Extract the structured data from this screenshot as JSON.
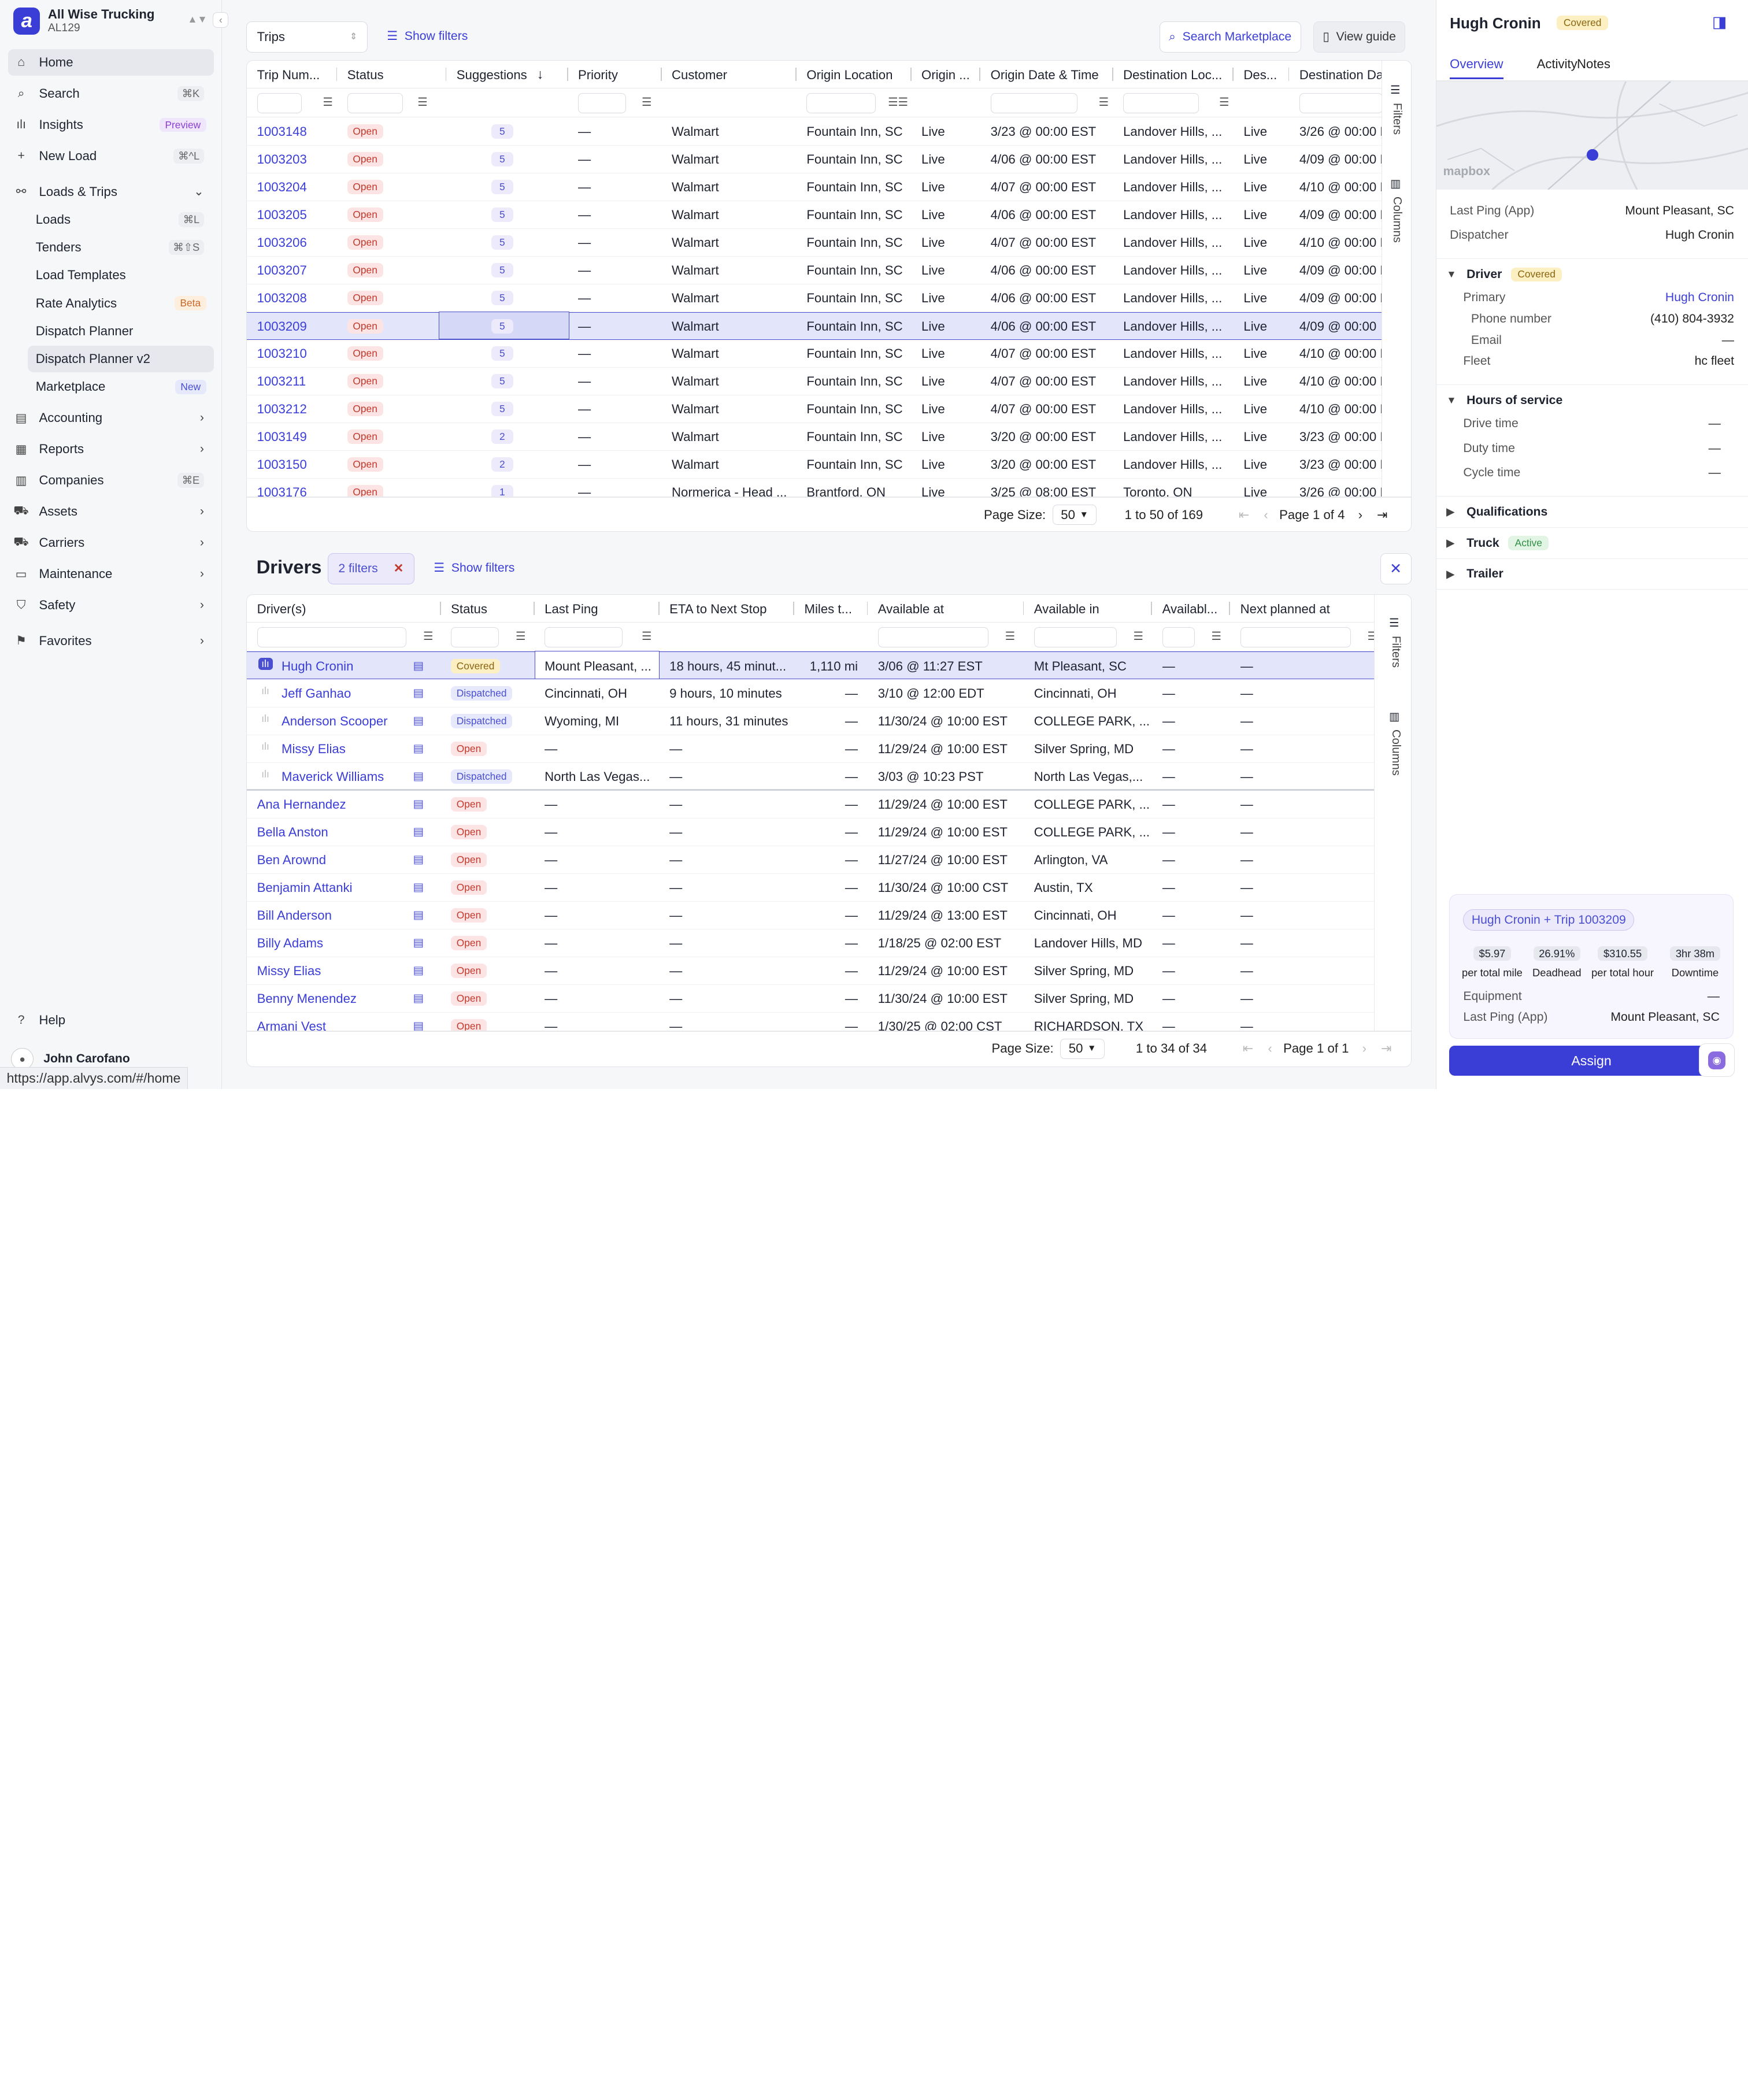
{
  "sidebar": {
    "org_name": "All Wise Trucking",
    "org_code": "AL129",
    "items": [
      {
        "label": "Home",
        "icon": "home-icon",
        "glyph": "⌂"
      },
      {
        "label": "Search",
        "icon": "search-icon",
        "glyph": "⌕",
        "kbd": "⌘K"
      },
      {
        "label": "Insights",
        "icon": "insights-icon",
        "glyph": "ılı",
        "tag": "Preview"
      },
      {
        "label": "New Load",
        "icon": "plus-icon",
        "glyph": "+",
        "kbd": "⌘^L"
      },
      {
        "label": "Loads & Trips",
        "icon": "route-icon",
        "glyph": "⚯"
      },
      {
        "label": "Loads",
        "kbd": "⌘L"
      },
      {
        "label": "Tenders",
        "kbd": "⌘⇧S"
      },
      {
        "label": "Load Templates"
      },
      {
        "label": "Rate Analytics",
        "tag": "Beta"
      },
      {
        "label": "Dispatch Planner"
      },
      {
        "label": "Dispatch Planner v2"
      },
      {
        "label": "Marketplace",
        "tag": "New"
      },
      {
        "label": "Accounting",
        "icon": "accounting-icon",
        "glyph": "▤"
      },
      {
        "label": "Reports",
        "icon": "reports-icon",
        "glyph": "▦"
      },
      {
        "label": "Companies",
        "icon": "companies-icon",
        "glyph": "▥",
        "kbd": "⌘E"
      },
      {
        "label": "Assets",
        "icon": "assets-icon",
        "glyph": "⛟"
      },
      {
        "label": "Carriers",
        "icon": "carriers-icon",
        "glyph": "⛟"
      },
      {
        "label": "Maintenance",
        "icon": "maintenance-icon",
        "glyph": "▭"
      },
      {
        "label": "Safety",
        "icon": "shield-icon",
        "glyph": "⛉"
      },
      {
        "label": "Favorites",
        "icon": "bookmark-icon",
        "glyph": "⚑"
      }
    ],
    "help": "Help",
    "user_name": "John Carofano"
  },
  "status_url": "https://app.alvys.com/#/home",
  "trips": {
    "select_value": "Trips",
    "show_filters": "Show filters",
    "search_marketplace": "Search Marketplace",
    "view_guide": "View guide",
    "columns": [
      "Trip Num...",
      "Status",
      "Suggestions",
      "Priority",
      "Customer",
      "Origin Location",
      "Origin ...",
      "Origin Date & Time",
      "Destination Loc...",
      "Des...",
      "Destination Da"
    ],
    "rows": [
      [
        "1003148",
        "Open",
        "5",
        "—",
        "Walmart",
        "Fountain Inn, SC",
        "Live",
        "3/23 @ 00:00 EST",
        "Landover Hills, ...",
        "Live",
        "3/26 @ 00:00 E"
      ],
      [
        "1003203",
        "Open",
        "5",
        "—",
        "Walmart",
        "Fountain Inn, SC",
        "Live",
        "4/06 @ 00:00 EST",
        "Landover Hills, ...",
        "Live",
        "4/09 @ 00:00 E"
      ],
      [
        "1003204",
        "Open",
        "5",
        "—",
        "Walmart",
        "Fountain Inn, SC",
        "Live",
        "4/07 @ 00:00 EST",
        "Landover Hills, ...",
        "Live",
        "4/10 @ 00:00 E"
      ],
      [
        "1003205",
        "Open",
        "5",
        "—",
        "Walmart",
        "Fountain Inn, SC",
        "Live",
        "4/06 @ 00:00 EST",
        "Landover Hills, ...",
        "Live",
        "4/09 @ 00:00 E"
      ],
      [
        "1003206",
        "Open",
        "5",
        "—",
        "Walmart",
        "Fountain Inn, SC",
        "Live",
        "4/07 @ 00:00 EST",
        "Landover Hills, ...",
        "Live",
        "4/10 @ 00:00 E"
      ],
      [
        "1003207",
        "Open",
        "5",
        "—",
        "Walmart",
        "Fountain Inn, SC",
        "Live",
        "4/06 @ 00:00 EST",
        "Landover Hills, ...",
        "Live",
        "4/09 @ 00:00 E"
      ],
      [
        "1003208",
        "Open",
        "5",
        "—",
        "Walmart",
        "Fountain Inn, SC",
        "Live",
        "4/06 @ 00:00 EST",
        "Landover Hills, ...",
        "Live",
        "4/09 @ 00:00 E"
      ],
      [
        "1003209",
        "Open",
        "5",
        "—",
        "Walmart",
        "Fountain Inn, SC",
        "Live",
        "4/06 @ 00:00 EST",
        "Landover Hills, ...",
        "Live",
        "4/09 @ 00:00"
      ],
      [
        "1003210",
        "Open",
        "5",
        "—",
        "Walmart",
        "Fountain Inn, SC",
        "Live",
        "4/07 @ 00:00 EST",
        "Landover Hills, ...",
        "Live",
        "4/10 @ 00:00 E"
      ],
      [
        "1003211",
        "Open",
        "5",
        "—",
        "Walmart",
        "Fountain Inn, SC",
        "Live",
        "4/07 @ 00:00 EST",
        "Landover Hills, ...",
        "Live",
        "4/10 @ 00:00 E"
      ],
      [
        "1003212",
        "Open",
        "5",
        "—",
        "Walmart",
        "Fountain Inn, SC",
        "Live",
        "4/07 @ 00:00 EST",
        "Landover Hills, ...",
        "Live",
        "4/10 @ 00:00 E"
      ],
      [
        "1003149",
        "Open",
        "2",
        "—",
        "Walmart",
        "Fountain Inn, SC",
        "Live",
        "3/20 @ 00:00 EST",
        "Landover Hills, ...",
        "Live",
        "3/23 @ 00:00 E"
      ],
      [
        "1003150",
        "Open",
        "2",
        "—",
        "Walmart",
        "Fountain Inn, SC",
        "Live",
        "3/20 @ 00:00 EST",
        "Landover Hills, ...",
        "Live",
        "3/23 @ 00:00 E"
      ],
      [
        "1003176",
        "Open",
        "1",
        "—",
        "Normerica - Head ...",
        "Brantford, ON",
        "Live",
        "3/25 @ 08:00 EST",
        "Toronto, ON",
        "Live",
        "3/26 @ 00:00 E"
      ]
    ],
    "page_size_label": "Page Size:",
    "page_size": "50",
    "range": "1 to 50 of 169",
    "page": "Page 1 of 4"
  },
  "drivers": {
    "title": "Drivers",
    "filter_chip": "2 filters",
    "show_filters": "Show filters",
    "columns": [
      "Driver(s)",
      "Status",
      "Last Ping",
      "ETA to Next Stop",
      "Miles t...",
      "Available at",
      "Available in",
      "Availabl...",
      "Next planned at"
    ],
    "rows": [
      [
        "Hugh Cronin",
        "Covered",
        "Mount Pleasant, ...",
        "18 hours, 45 minut...",
        "1,110 mi",
        "3/06 @ 11:27 EST",
        "Mt Pleasant, SC",
        "—",
        "—"
      ],
      [
        "Jeff Ganhao",
        "Dispatched",
        "Cincinnati, OH",
        "9 hours, 10 minutes",
        "—",
        "3/10 @ 12:00 EDT",
        "Cincinnati, OH",
        "—",
        "—"
      ],
      [
        "Anderson Scooper",
        "Dispatched",
        "Wyoming, MI",
        "11 hours, 31 minutes",
        "—",
        "11/30/24 @ 10:00 EST",
        "COLLEGE PARK, ...",
        "—",
        "—"
      ],
      [
        "Missy Elias",
        "Open",
        "—",
        "—",
        "—",
        "11/29/24 @ 10:00 EST",
        "Silver Spring, MD",
        "—",
        "—"
      ],
      [
        "Maverick Williams",
        "Dispatched",
        "North Las Vegas...",
        "—",
        "—",
        "3/03 @ 10:23 PST",
        "North Las Vegas,...",
        "—",
        "—"
      ],
      [
        "Ana Hernandez",
        "Open",
        "—",
        "—",
        "—",
        "11/29/24 @ 10:00 EST",
        "COLLEGE PARK, ...",
        "—",
        "—"
      ],
      [
        "Bella Anston",
        "Open",
        "—",
        "—",
        "—",
        "11/29/24 @ 10:00 EST",
        "COLLEGE PARK, ...",
        "—",
        "—"
      ],
      [
        "Ben Arownd",
        "Open",
        "—",
        "—",
        "—",
        "11/27/24 @ 10:00 EST",
        "Arlington, VA",
        "—",
        "—"
      ],
      [
        "Benjamin Attanki",
        "Open",
        "—",
        "—",
        "—",
        "11/30/24 @ 10:00 CST",
        "Austin, TX",
        "—",
        "—"
      ],
      [
        "Bill Anderson",
        "Open",
        "—",
        "—",
        "—",
        "11/29/24 @ 13:00 EST",
        "Cincinnati, OH",
        "—",
        "—"
      ],
      [
        "Billy Adams",
        "Open",
        "—",
        "—",
        "—",
        "1/18/25 @ 02:00 EST",
        "Landover Hills, MD",
        "—",
        "—"
      ],
      [
        "Missy Elias",
        "Open",
        "—",
        "—",
        "—",
        "11/29/24 @ 10:00 EST",
        "Silver Spring, MD",
        "—",
        "—"
      ],
      [
        "Benny Menendez",
        "Open",
        "—",
        "—",
        "—",
        "11/30/24 @ 10:00 EST",
        "Silver Spring, MD",
        "—",
        "—"
      ],
      [
        "Armani Vest",
        "Open",
        "—",
        "—",
        "—",
        "1/30/25 @ 02:00 CST",
        "RICHARDSON, TX",
        "—",
        "—"
      ]
    ],
    "page_size_label": "Page Size:",
    "page_size": "50",
    "range": "1 to 34 of 34",
    "page": "Page 1 of 1"
  },
  "vertical": {
    "filters": "Filters",
    "columns": "Columns"
  },
  "detail": {
    "name": "Hugh Cronin",
    "badge": "Covered",
    "tabs": [
      "Overview",
      "Activity",
      "Notes"
    ],
    "map_label": "mapbox",
    "last_ping_label": "Last Ping (App)",
    "last_ping": "Mount Pleasant, SC",
    "dispatcher_label": "Dispatcher",
    "dispatcher": "Hugh Cronin",
    "driver_section": "Driver",
    "driver_badge": "Covered",
    "primary_label": "Primary",
    "primary": "Hugh Cronin",
    "phone_label": "Phone number",
    "phone": "(410) 804-3932",
    "email_label": "Email",
    "email": "—",
    "fleet_label": "Fleet",
    "fleet": "hc fleet",
    "hos_section": "Hours of service",
    "drive_label": "Drive time",
    "drive": "—",
    "duty_label": "Duty time",
    "duty": "—",
    "cycle_label": "Cycle time",
    "cycle": "—",
    "qual_section": "Qualifications",
    "truck_section": "Truck",
    "truck_badge": "Active",
    "trailer_section": "Trailer",
    "card_title": "Hugh Cronin + Trip 1003209",
    "metrics": [
      [
        "$5.97",
        "per total mile"
      ],
      [
        "26.91%",
        "Deadhead"
      ],
      [
        "$310.55",
        "per total hour"
      ],
      [
        "3hr 38m",
        "Downtime"
      ]
    ],
    "equipment_label": "Equipment",
    "equipment": "—",
    "card_ping_label": "Last Ping (App)",
    "card_ping": "Mount Pleasant, SC",
    "assign": "Assign"
  }
}
